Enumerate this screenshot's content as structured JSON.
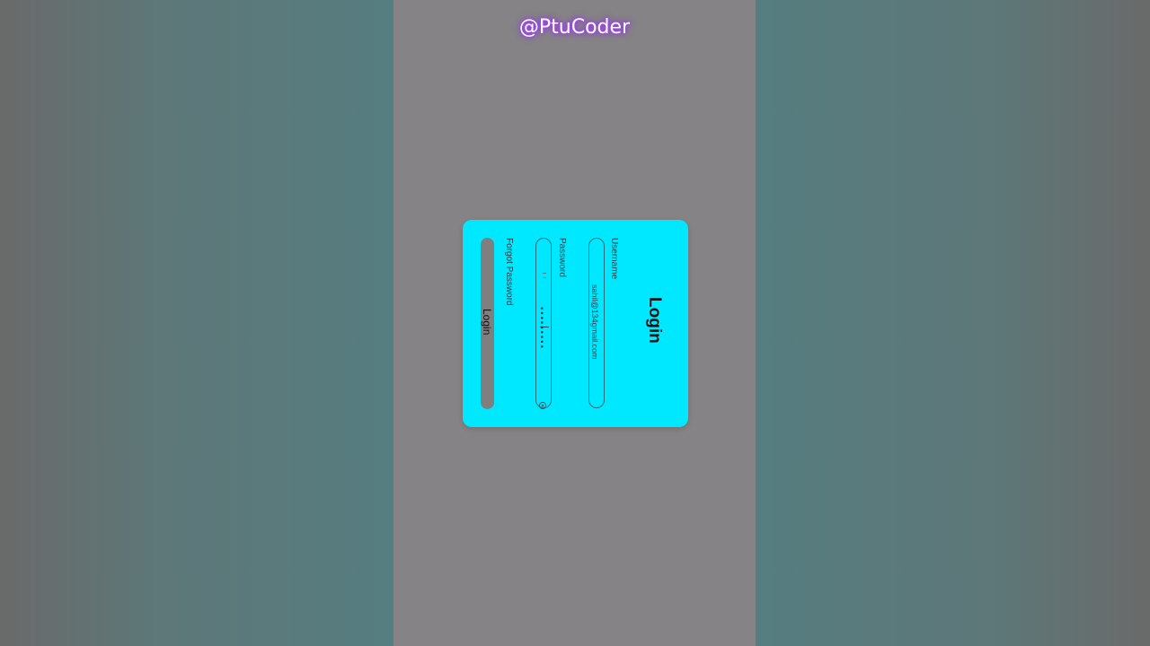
{
  "watermark": "@PtuCoder",
  "login_form": {
    "title": "Login",
    "username_label": "Username",
    "username_value": "sahil@134gmail.com",
    "password_label": "Password",
    "password_value": "•••••••••",
    "forgot_label": "Forgot Password",
    "login_button_label": "Login"
  },
  "colors": {
    "card_background": "#00e8ff",
    "page_background": "#858385",
    "button_background": "#7f7f80",
    "watermark_glow": "#a43cff"
  },
  "icons": {
    "password_toggle": "eye-icon"
  }
}
